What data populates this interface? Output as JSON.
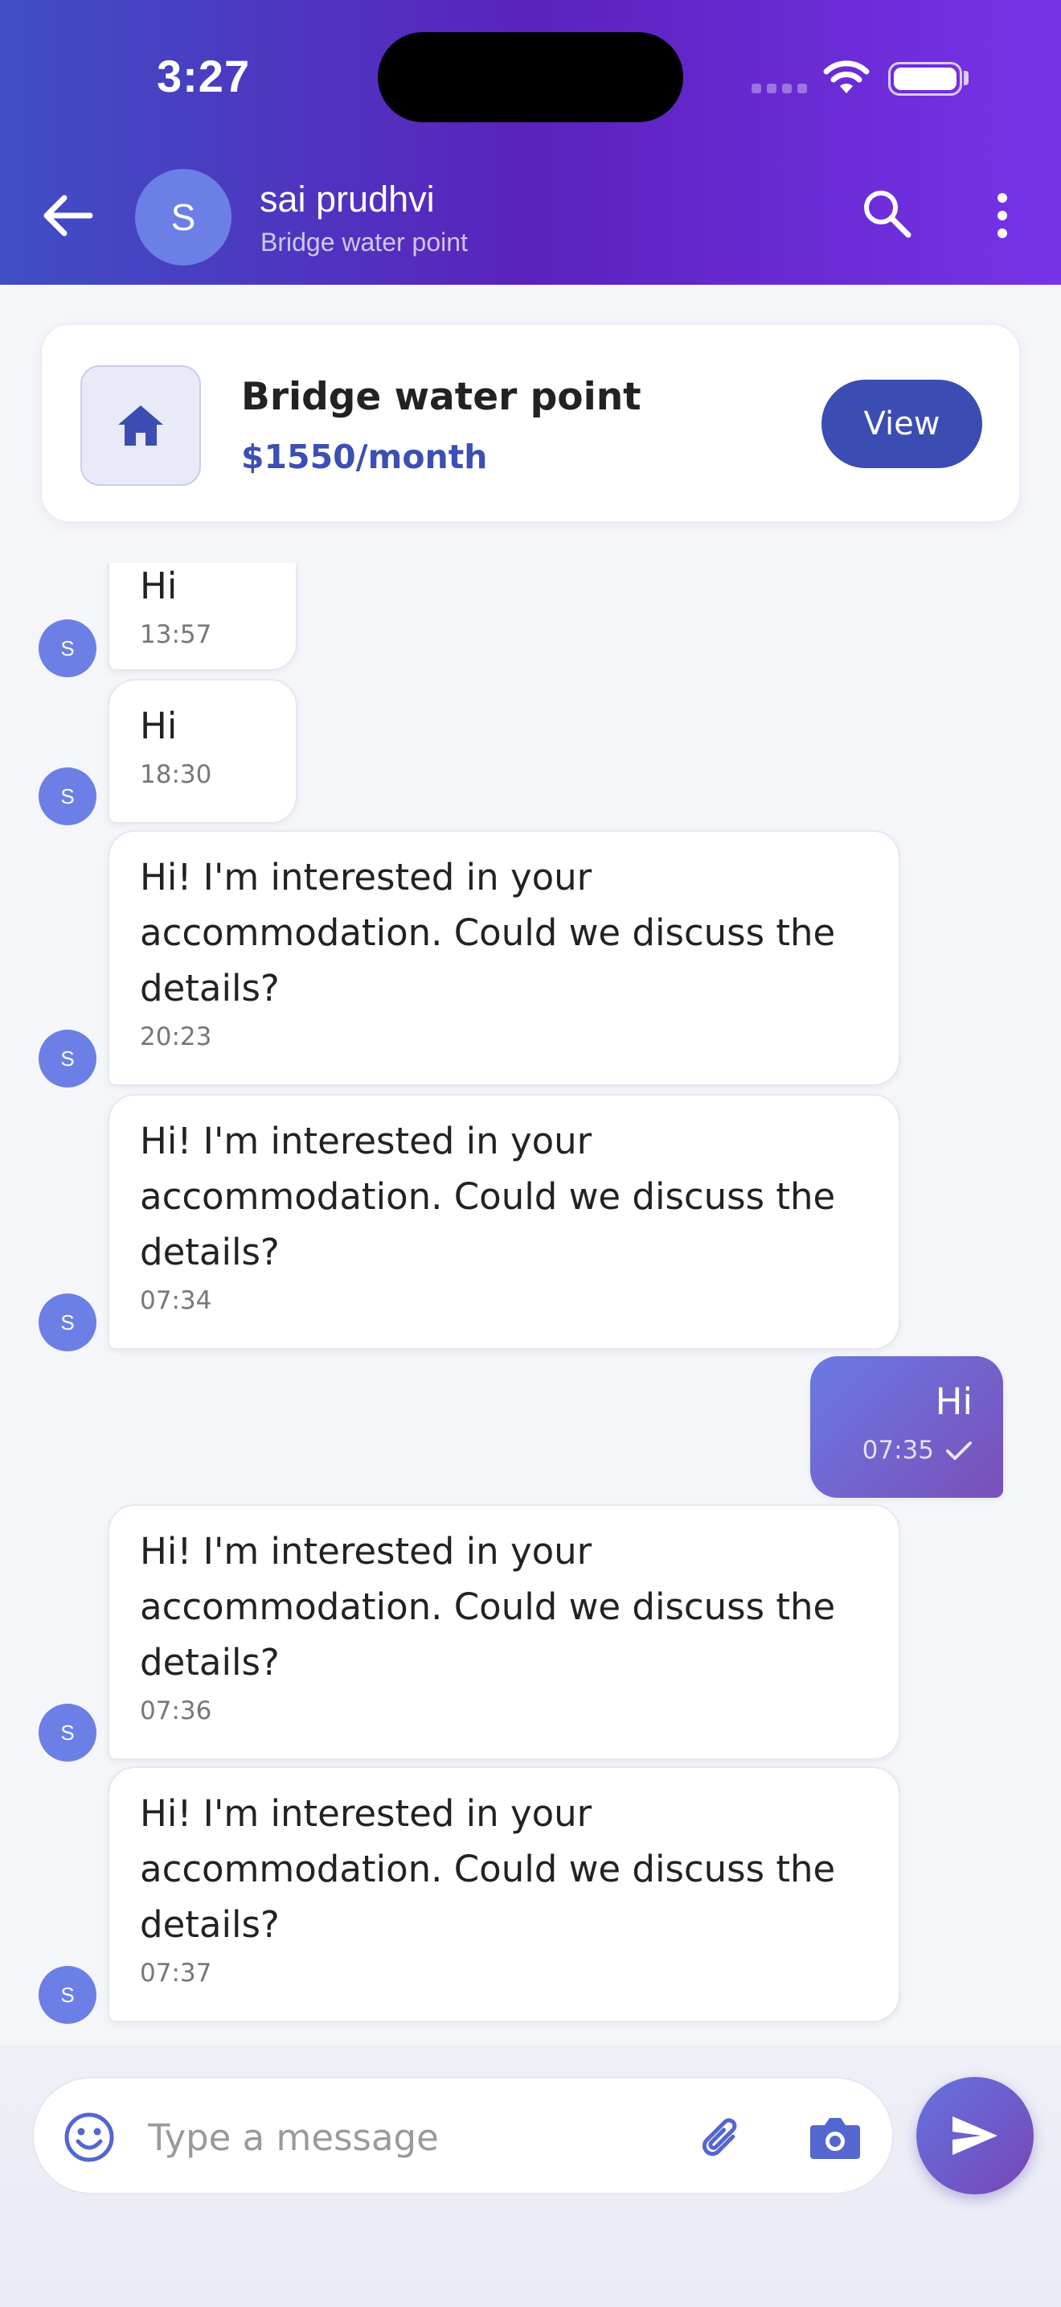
{
  "status_bar": {
    "time": "3:27"
  },
  "header": {
    "contact_name": "sai prudhvi",
    "contact_subtitle": "Bridge water point",
    "avatar_initial": "S",
    "back_icon": "arrow-left-icon",
    "search_icon": "search-icon",
    "more_icon": "more-vertical-icon"
  },
  "property": {
    "title": "Bridge water point",
    "price": "$1550/month",
    "view_label": "View",
    "icon": "home-icon"
  },
  "messages": [
    {
      "direction": "in",
      "avatar": "S",
      "text": "Hi",
      "time": "13:57"
    },
    {
      "direction": "in",
      "avatar": "S",
      "text": "Hi",
      "time": "18:30"
    },
    {
      "direction": "in",
      "avatar": "S",
      "text": "Hi! I'm interested in your accommodation. Could we discuss the details?",
      "time": "20:23"
    },
    {
      "direction": "in",
      "avatar": "S",
      "text": "Hi! I'm interested in your accommodation. Could we discuss the details?",
      "time": "07:34"
    },
    {
      "direction": "out",
      "text": "Hi",
      "time": "07:35",
      "status": "sent"
    },
    {
      "direction": "in",
      "avatar": "S",
      "text": "Hi! I'm interested in your accommodation. Could we discuss the details?",
      "time": "07:36"
    },
    {
      "direction": "in",
      "avatar": "S",
      "text": "Hi! I'm interested in your accommodation. Could we discuss the details?",
      "time": "07:37"
    }
  ],
  "composer": {
    "placeholder": "Type a message",
    "value": "",
    "emoji_icon": "emoji-icon",
    "attach_icon": "paperclip-icon",
    "camera_icon": "camera-icon",
    "send_icon": "send-icon"
  },
  "colors": {
    "header_start": "#3f4fc4",
    "header_end": "#7733e8",
    "accent": "#3b4db3",
    "avatar": "#6c7fe6",
    "outgoing_bubble": "#6a7ae4"
  }
}
